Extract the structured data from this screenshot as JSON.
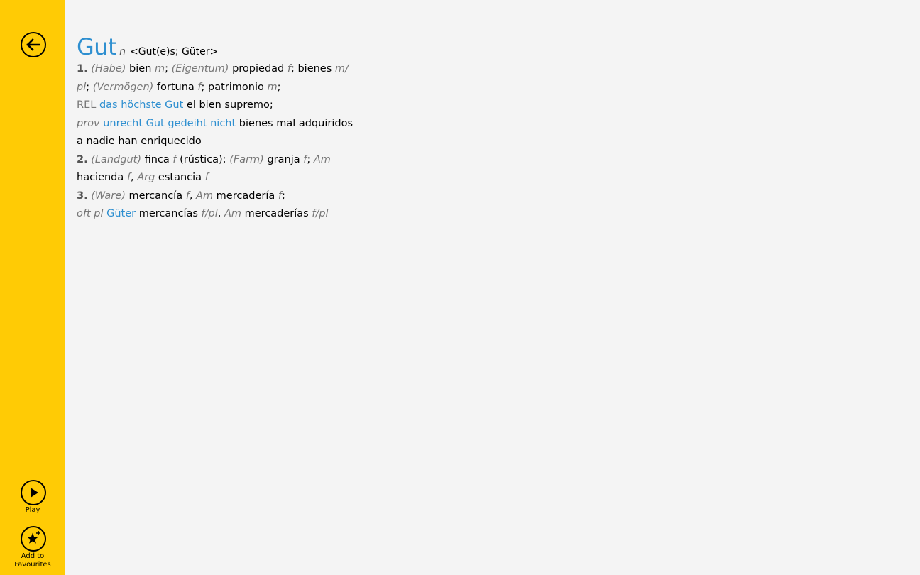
{
  "sidebar": {
    "back": {
      "icon": "back-arrow-icon"
    },
    "play": {
      "label": "Play",
      "icon": "play-icon"
    },
    "favourites": {
      "label_line1": "Add to",
      "label_line2": "Favourites",
      "icon": "star-add-icon"
    }
  },
  "colors": {
    "accent": "#ffcb05",
    "link": "#2e8fd0",
    "background": "#f4f4f4"
  },
  "entry": {
    "headword": "Gut",
    "pos": "n",
    "forms": "<Gut(e)s; Güter>",
    "lines": [
      [
        "1.",
        " ",
        "(Habe)",
        " bien ",
        "m",
        "; ",
        "(Eigentum)",
        " propiedad ",
        "f",
        "; bienes ",
        "m/"
      ],
      [
        "pl",
        "; ",
        "(Vermögen)",
        " fortuna ",
        "f",
        "; patrimonio ",
        "m",
        ";"
      ],
      [
        "REL",
        " ",
        "das höchste Gut",
        " el bien supremo;"
      ],
      [
        "prov",
        " ",
        "unrecht Gut gedeiht nicht",
        " bienes mal adquiridos"
      ],
      [
        "a nadie han enriquecido"
      ],
      [
        "2.",
        " ",
        "(Landgut)",
        " finca ",
        "f",
        " (rústica); ",
        "(Farm)",
        " granja ",
        "f",
        "; ",
        "Am"
      ],
      [
        "hacienda ",
        "f",
        ", ",
        "Arg",
        " estancia ",
        "f"
      ],
      [
        "3.",
        " ",
        "(Ware)",
        " mercancía ",
        "f",
        ", ",
        "Am",
        " mercadería ",
        "f",
        ";"
      ],
      [
        "oft pl",
        " ",
        "Güter",
        " mercancías ",
        "f/pl",
        ", ",
        "Am",
        " mercaderías ",
        "f/pl"
      ]
    ]
  }
}
